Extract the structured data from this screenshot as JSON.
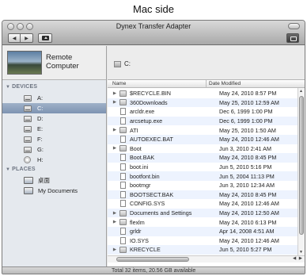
{
  "caption": "Mac side",
  "window": {
    "title": "Dynex Transfer Adapter"
  },
  "toolbar": {
    "back_icon": "back-arrow-icon",
    "forward_icon": "forward-arrow-icon",
    "up_icon": "folder-up-icon",
    "back_glyph": "◀",
    "forward_glyph": "▶"
  },
  "sidebar": {
    "remote_label_line1": "Remote",
    "remote_label_line2": "Computer",
    "devices_header": "DEVICES",
    "places_header": "PLACES",
    "triangle": "▼",
    "devices": [
      {
        "label": "A:",
        "selected": false
      },
      {
        "label": "C:",
        "selected": true
      },
      {
        "label": "D:",
        "selected": false
      },
      {
        "label": "E:",
        "selected": false
      },
      {
        "label": "F:",
        "selected": false
      },
      {
        "label": "G:",
        "selected": false
      },
      {
        "label": "H:",
        "selected": false
      }
    ],
    "places": [
      {
        "label": "桌面"
      },
      {
        "label": "My Documents"
      }
    ]
  },
  "main": {
    "path": "C:",
    "col_name": "Name",
    "col_date": "Date Modified",
    "files": [
      {
        "name": "$RECYCLE.BIN",
        "date": "May 24, 2010 8:57 PM",
        "type": "folder"
      },
      {
        "name": "360Downloads",
        "date": "May 25, 2010 12:59 AM",
        "type": "folder"
      },
      {
        "name": "arcldr.exe",
        "date": "Dec 6, 1999 1:00 PM",
        "type": "file"
      },
      {
        "name": "arcsetup.exe",
        "date": "Dec 6, 1999 1:00 PM",
        "type": "file"
      },
      {
        "name": "ATI",
        "date": "May 25, 2010 1:50 AM",
        "type": "folder"
      },
      {
        "name": "AUTOEXEC.BAT",
        "date": "May 24, 2010 12:46 AM",
        "type": "file"
      },
      {
        "name": "Boot",
        "date": "Jun 3, 2010 2:41 AM",
        "type": "folder"
      },
      {
        "name": "Boot.BAK",
        "date": "May 24, 2010 8:45 PM",
        "type": "file"
      },
      {
        "name": "boot.ini",
        "date": "Jun 5, 2010 5:16 PM",
        "type": "file"
      },
      {
        "name": "bootfont.bin",
        "date": "Jun 5, 2004 11:13 PM",
        "type": "file"
      },
      {
        "name": "bootmgr",
        "date": "Jun 3, 2010 12:34 AM",
        "type": "file"
      },
      {
        "name": "BOOTSECT.BAK",
        "date": "May 24, 2010 8:45 PM",
        "type": "file"
      },
      {
        "name": "CONFIG.SYS",
        "date": "May 24, 2010 12:46 AM",
        "type": "file"
      },
      {
        "name": "Documents and Settings",
        "date": "May 24, 2010 12:50 AM",
        "type": "folder"
      },
      {
        "name": "flexlm",
        "date": "May 24, 2010 6:13 PM",
        "type": "folder"
      },
      {
        "name": "grldr",
        "date": "Apr 14, 2008 4:51 AM",
        "type": "file"
      },
      {
        "name": "IO.SYS",
        "date": "May 24, 2010 12:46 AM",
        "type": "file"
      },
      {
        "name": "KRECYCLE",
        "date": "Jun 5, 2010 5:27 PM",
        "type": "folder"
      }
    ],
    "expand_glyph": "▶",
    "vscroll_up": "▲",
    "vscroll_down": "▼",
    "hscroll_arrows": "◀ ▶"
  },
  "status": {
    "text": "Total 32 items, 20.56 GB available"
  }
}
